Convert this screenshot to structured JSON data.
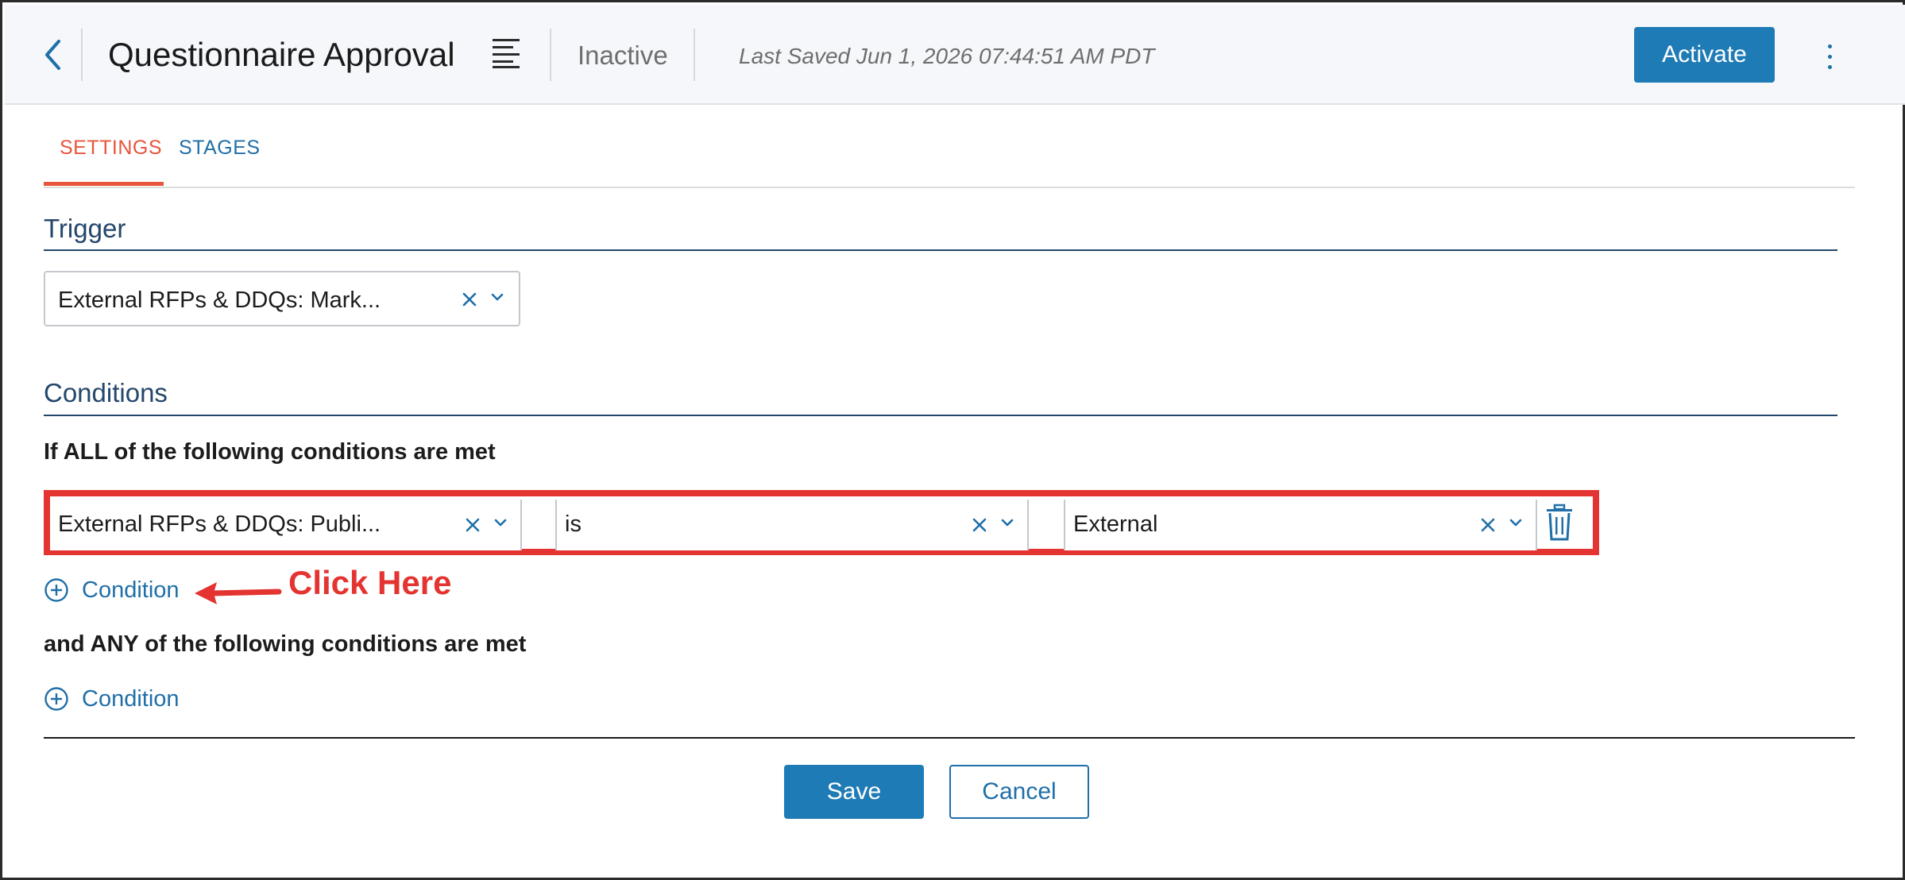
{
  "header": {
    "title": "Questionnaire Approval",
    "status": "Inactive",
    "last_saved": "Last Saved Jun 1, 2026 07:44:51 AM PDT",
    "activate_label": "Activate",
    "back_icon": "chevron-left-icon",
    "title_icon": "align-left-icon",
    "more_icon": "vertical-ellipsis-icon"
  },
  "tabs": [
    {
      "label": "SETTINGS",
      "active": true
    },
    {
      "label": "STAGES",
      "active": false
    }
  ],
  "trigger": {
    "heading": "Trigger",
    "selected": "External RFPs & DDQs: Mark..."
  },
  "conditions": {
    "heading": "Conditions",
    "all_label": "If ALL of the following conditions are met",
    "any_label": "and ANY of the following conditions are met",
    "rows": [
      {
        "field": "External RFPs & DDQs: Publi...",
        "operator": "is",
        "value": "External"
      }
    ],
    "add_label": "Condition"
  },
  "annotation": {
    "text": "Click Here"
  },
  "footer": {
    "save_label": "Save",
    "cancel_label": "Cancel"
  },
  "colors": {
    "primary": "#1f7bb6",
    "link": "#1f6fa8",
    "accent_tab": "#e8553c",
    "annotation": "#e43431",
    "heading": "#24476b"
  }
}
